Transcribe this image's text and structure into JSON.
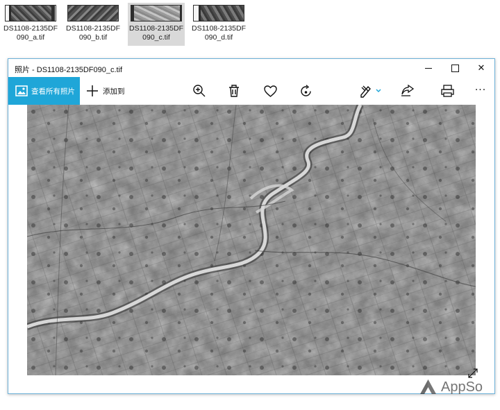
{
  "explorer": {
    "files": [
      {
        "line1": "DS1108-2135DF",
        "line2": "090_a.tif",
        "selected": false
      },
      {
        "line1": "DS1108-2135DF",
        "line2": "090_b.tif",
        "selected": false
      },
      {
        "line1": "DS1108-2135DF",
        "line2": "090_c.tif",
        "selected": true
      },
      {
        "line1": "DS1108-2135DF",
        "line2": "090_d.tif",
        "selected": false
      }
    ]
  },
  "photos_window": {
    "title": "照片 - DS1108-2135DF090_c.tif",
    "controls": {
      "minimize_icon": "minimize-icon",
      "maximize_icon": "maximize-icon",
      "close_icon": "close-icon",
      "close_glyph": "✕"
    },
    "toolbar": {
      "view_all_label": "查看所有照片",
      "add_to_label": "添加到",
      "more_glyph": "···"
    },
    "image": {
      "description": "",
      "accent": "#1fa6d8"
    }
  },
  "watermark": {
    "text": "AppSo"
  }
}
